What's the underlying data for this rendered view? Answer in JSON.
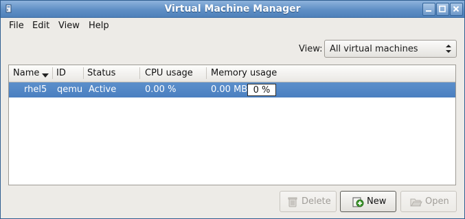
{
  "window": {
    "title": "Virtual Machine Manager"
  },
  "menubar": {
    "items": [
      "File",
      "Edit",
      "View",
      "Help"
    ]
  },
  "view_filter": {
    "label": "View:",
    "selected": "All virtual machines"
  },
  "vm_list": {
    "columns": [
      "Name",
      "ID",
      "Status",
      "CPU usage",
      "Memory usage"
    ],
    "sort_column": "Name",
    "rows": [
      {
        "name": "rhel5",
        "id": "qemu",
        "status": "Active",
        "cpu_usage": "0.00 %",
        "memory": "0.00 MB",
        "memory_percent_label": "0 %",
        "memory_percent": 0,
        "selected": true
      }
    ]
  },
  "buttons": {
    "delete": "Delete",
    "new": "New",
    "open": "Open"
  },
  "colors": {
    "titlebar": "#5f8fc5",
    "selection": "#4a7fc0",
    "window_bg": "#edebe7"
  },
  "icons": {
    "app": "app-window-icon",
    "minimize": "minimize-icon",
    "maximize": "maximize-icon",
    "close": "close-icon",
    "delete": "trash-icon",
    "new": "new-vm-icon",
    "open": "folder-open-icon"
  }
}
